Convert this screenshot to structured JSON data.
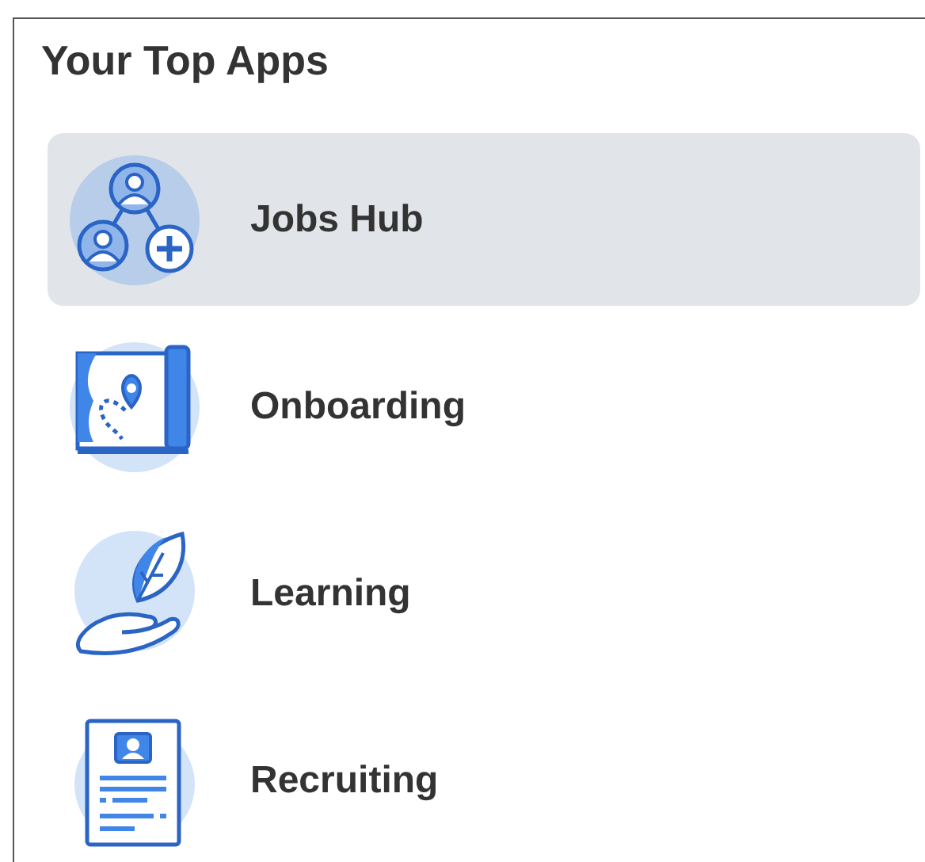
{
  "card": {
    "title": "Your Top Apps",
    "apps": [
      {
        "label": "Jobs Hub",
        "selected": true
      },
      {
        "label": "Onboarding",
        "selected": false
      },
      {
        "label": "Learning",
        "selected": false
      },
      {
        "label": "Recruiting",
        "selected": false
      }
    ]
  }
}
